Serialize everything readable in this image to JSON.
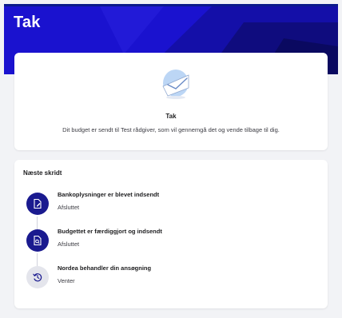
{
  "header": {
    "title": "Tak"
  },
  "confirmation": {
    "title": "Tak",
    "message": "Dit budget er sendt til Test rådgiver, som vil gennemgå det og vende tilbage til dig."
  },
  "next_steps": {
    "heading": "Næste skridt",
    "items": [
      {
        "title": "Bankoplysninger er blevet indsendt",
        "status": "Afsluttet",
        "state": "done",
        "icon": "document-edit-icon"
      },
      {
        "title": "Budgettet er færdiggjort og indsendt",
        "status": "Afsluttet",
        "state": "done",
        "icon": "document-search-icon"
      },
      {
        "title": "Nordea behandler din ansøgning",
        "status": "Venter",
        "state": "pending",
        "icon": "clock-rewind-icon"
      }
    ]
  },
  "colors": {
    "brand_blue": "#1a12cf",
    "step_done": "#1a1a8f",
    "step_pending": "#e4e5ec",
    "background": "#f2f3f6"
  }
}
